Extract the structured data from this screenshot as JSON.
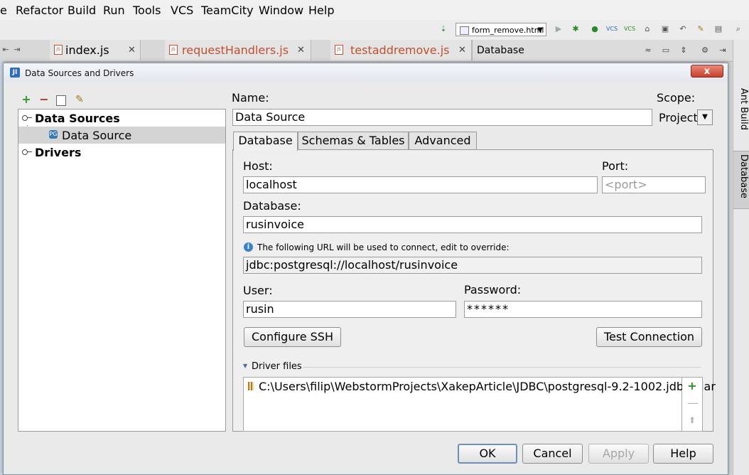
{
  "menu": {
    "items": [
      "e",
      "Refactor",
      "Build",
      "Run",
      "Tools",
      "VCS",
      "TeamCity",
      "Window",
      "Help"
    ]
  },
  "toolbar": {
    "run_config": "form_remove.html",
    "icons": [
      "sort-icon",
      "run-icon",
      "debug-icon",
      "vcs-update-icon",
      "vcs-commit-icon",
      "lock-icon",
      "history-icon",
      "revert-icon",
      "settings-icon",
      "structure-icon",
      "search-icon"
    ]
  },
  "editor_tabs": [
    {
      "label": "index.js",
      "color": "#000000"
    },
    {
      "label": "requestHandlers.js",
      "color": "#c0502e"
    },
    {
      "label": "testaddremove.js",
      "color": "#c0502e"
    }
  ],
  "db_panel": {
    "title": "Database"
  },
  "right_rail": {
    "ant": "Ant Build",
    "database": "Database"
  },
  "dialog": {
    "title": "Data Sources and Drivers",
    "close_glyph": "x",
    "tree": {
      "data_sources": "Data Sources",
      "data_source": "Data Source",
      "drivers": "Drivers"
    },
    "name_label": "Name:",
    "name_value": "Data Source",
    "scope_label": "Scope:",
    "scope_value": "Project",
    "tabs": [
      "Database",
      "Schemas & Tables",
      "Advanced"
    ],
    "host_label": "Host:",
    "host_value": "localhost",
    "port_label": "Port:",
    "port_placeholder": "<port>",
    "database_label": "Database:",
    "database_value": "rusinvoice",
    "url_hint": "The following URL will be used to connect, edit to override:",
    "url_value": "jdbc:postgresql://localhost/rusinvoice",
    "user_label": "User:",
    "user_value": "rusin",
    "password_label": "Password:",
    "password_value": "******",
    "configure_ssh": "Configure SSH",
    "test_connection": "Test Connection",
    "driver_files_label": "Driver files",
    "driver_files": [
      "C:\\Users\\filip\\WebstormProjects\\XakepArticle\\JDBC\\postgresql-9.2-1002.jdbc4.jar"
    ],
    "buttons": {
      "ok": "OK",
      "cancel": "Cancel",
      "apply": "Apply",
      "help": "Help"
    }
  }
}
